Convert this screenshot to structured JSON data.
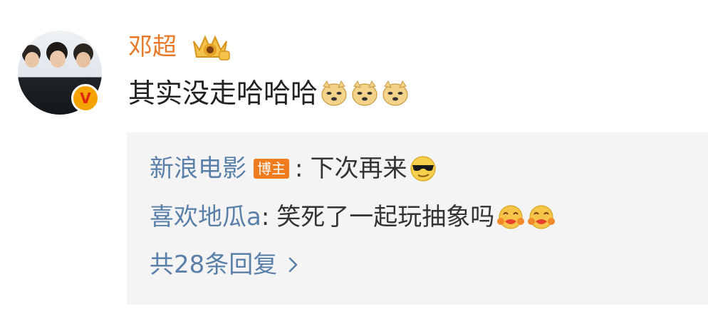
{
  "comment": {
    "username": "邓超",
    "text": "其实没走哈哈哈",
    "emoji_icons": [
      "doge-emoji",
      "doge-emoji",
      "doge-emoji"
    ]
  },
  "replies": [
    {
      "name": "新浪电影",
      "badge": "博主",
      "separator": ":",
      "text": "下次再来",
      "emoji": "cool-sunglasses-emoji"
    },
    {
      "name": "喜欢地瓜a",
      "separator": ":",
      "text": "笑死了一起玩抽象吗",
      "emoji": "love-hug-emoji"
    }
  ],
  "more_replies_label": "共28条回复",
  "colors": {
    "username": "#e8792a",
    "link": "#5a7fa8",
    "badge": "#f07c1e",
    "reply_background": "#f4f4f4"
  }
}
